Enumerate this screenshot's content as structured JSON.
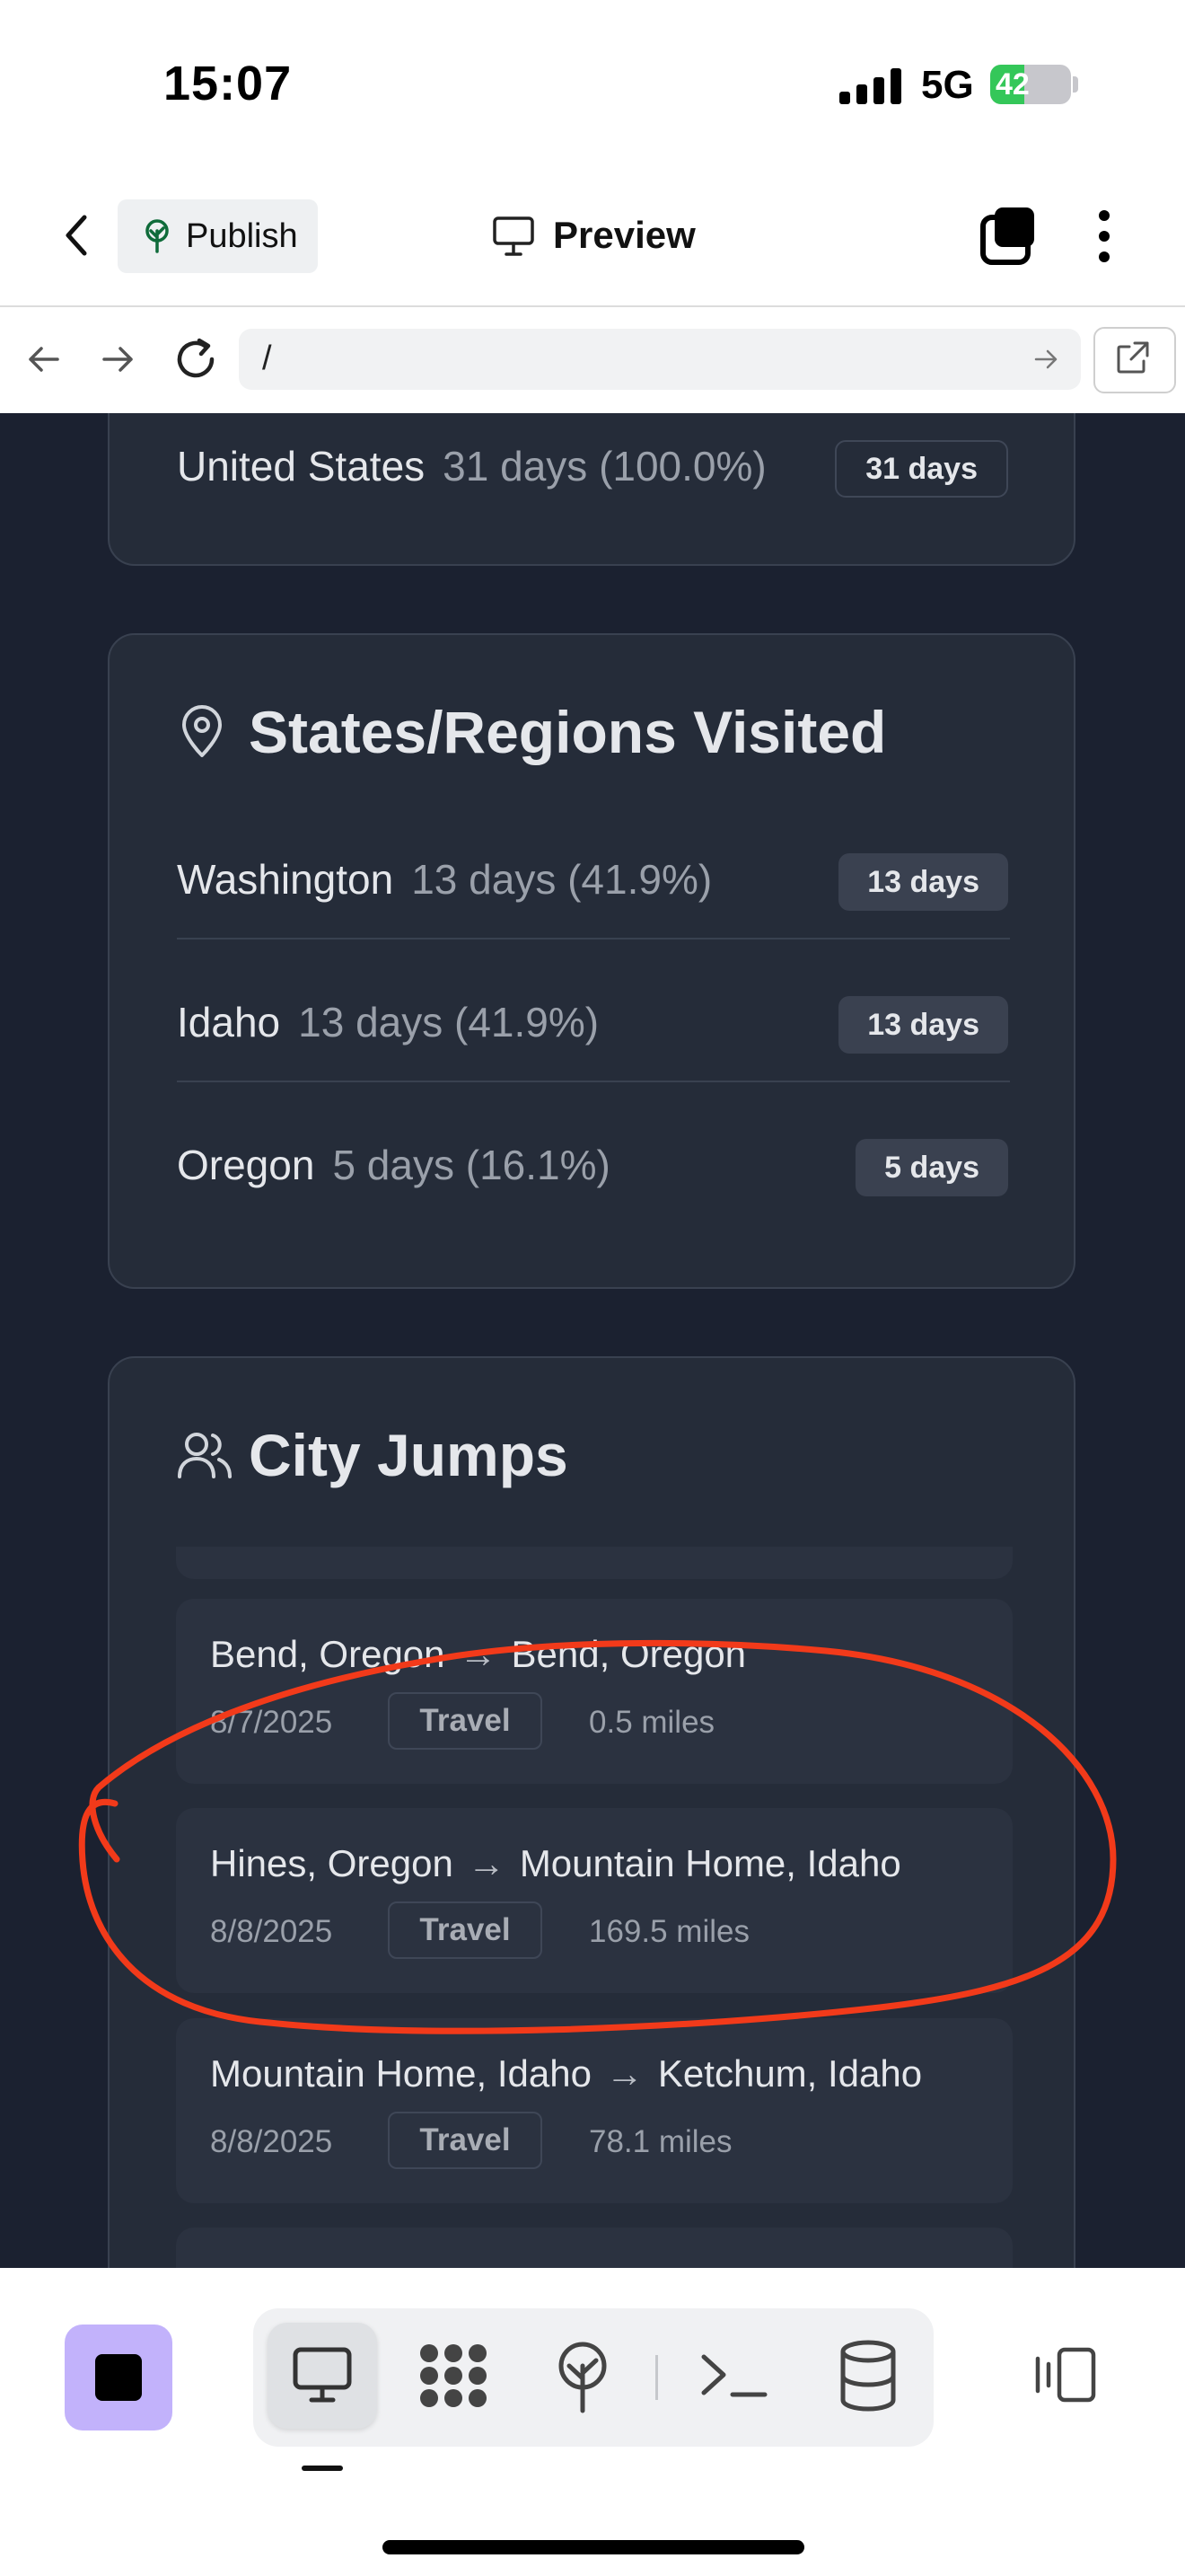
{
  "status_bar": {
    "time": "15:07",
    "network": "5G",
    "battery": "42",
    "battery_level": 0.42
  },
  "header": {
    "publish_label": "Publish",
    "preview_label": "Preview"
  },
  "browser": {
    "url": "/"
  },
  "countries_card": {
    "rows": [
      {
        "name": "United States",
        "detail": "31 days (100.0%)",
        "badge": "31 days"
      }
    ]
  },
  "regions_card": {
    "title": "States/Regions Visited",
    "rows": [
      {
        "name": "Washington",
        "detail": "13 days (41.9%)",
        "badge": "13 days"
      },
      {
        "name": "Idaho",
        "detail": "13 days (41.9%)",
        "badge": "13 days"
      },
      {
        "name": "Oregon",
        "detail": "5 days (16.1%)",
        "badge": "5 days"
      }
    ]
  },
  "jumps_card": {
    "title": "City Jumps",
    "items": [
      {
        "from": "Bend, Oregon",
        "to": "Bend, Oregon",
        "date": "8/7/2025",
        "type": "Travel",
        "distance": "0.5 miles"
      },
      {
        "from": "Hines, Oregon",
        "to": "Mountain Home, Idaho",
        "date": "8/8/2025",
        "type": "Travel",
        "distance": "169.5 miles"
      },
      {
        "from": "Mountain Home, Idaho",
        "to": "Ketchum, Idaho",
        "date": "8/8/2025",
        "type": "Travel",
        "distance": "78.1 miles"
      }
    ]
  },
  "arrow_glyph": "→",
  "icons": {
    "back": "chevron-left-icon",
    "publish": "tree-icon",
    "preview": "monitor-icon",
    "layers": "layers-icon",
    "more": "more-vertical-icon",
    "nav_back": "arrow-left-icon",
    "nav_forward": "arrow-right-icon",
    "reload": "reload-icon",
    "url_go": "arrow-right-icon",
    "external": "external-link-icon",
    "regions": "map-pin-icon",
    "jumps": "users-icon",
    "stop": "stop-icon",
    "tool_preview": "monitor-icon",
    "tool_grid": "grid-icon",
    "tool_deploy": "tree-icon",
    "tool_console": "terminal-icon",
    "tool_database": "database-icon",
    "panel": "panel-toggle-icon"
  },
  "colors": {
    "content_bg": "#1b2130",
    "card_bg": "#252c39",
    "accent_stop": "#c2b2fb",
    "annotation": "#f23a1a",
    "battery_green": "#34c759"
  }
}
